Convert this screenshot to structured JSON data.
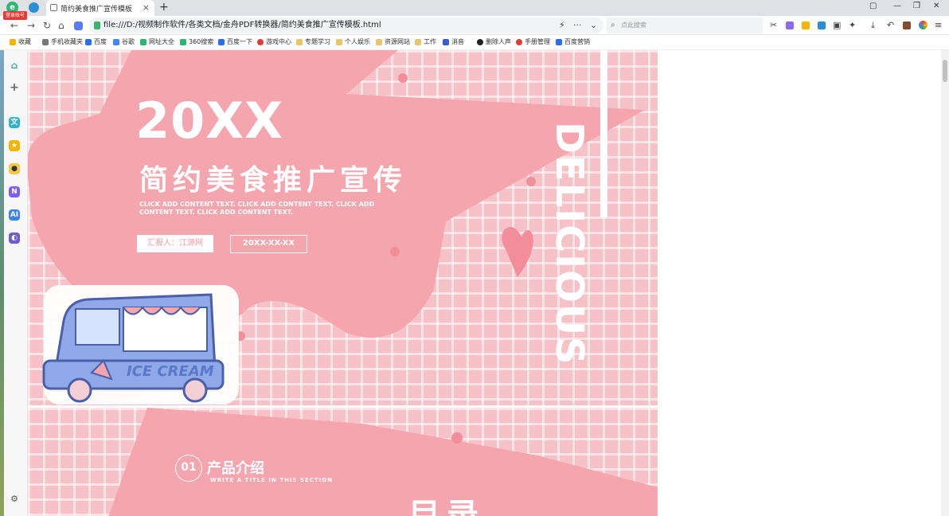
{
  "tab": {
    "title": "简约美食推广宣传模板"
  },
  "badge": "登录账号",
  "address": {
    "url": "file:///D:/视频制作软件/各类文档/金舟PDF转换器/简约美食推广宣传模板.html"
  },
  "search": {
    "placeholder": "点此搜索"
  },
  "bookmarks": [
    "收藏",
    "手机收藏夹",
    "百度",
    "谷歌",
    "网址大全",
    "360搜索",
    "百度一下",
    "游戏中心",
    "专题学习",
    "个人娱乐",
    "资源网站",
    "工作",
    "消音",
    "删除人声",
    "手册管理",
    "百度营销"
  ],
  "slide1": {
    "year": "20XX",
    "title": "简约美食推广宣传",
    "subtitle": "CLICK ADD CONTENT TEXT. CLICK ADD CONTENT TEXT. CLICK ADD CONTENT TEXT. CLICK ADD CONTENT TEXT.",
    "reporter": "汇报人：江源网",
    "date": "20XX-XX-XX",
    "vertical": "DELICIOUS",
    "truck_label": "ICE CREAM"
  },
  "slide2": {
    "number": "01",
    "section": "产品介绍",
    "section_sub": "WRITE A TITLE IN THIS SECTION",
    "heading": "目录"
  },
  "colors": {
    "pink_bg": "#f6c2c7",
    "pink_blob": "#f4a5ad",
    "accent": "#f59aa5"
  }
}
